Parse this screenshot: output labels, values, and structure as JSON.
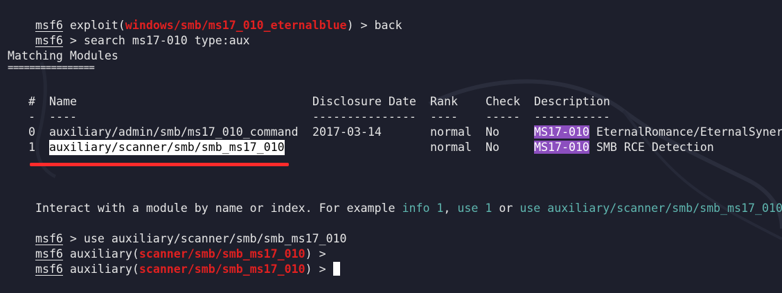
{
  "prompt": {
    "name": "msf6"
  },
  "lines": {
    "l1": {
      "pre": " exploit(",
      "module": "windows/smb/ms17_010_eternalblue",
      "post": ") > back"
    },
    "l2": {
      "text": " > search ms17-010 type:aux"
    },
    "matching_title": "Matching Modules",
    "matching_underline": "================",
    "headers": {
      "num": "#",
      "name": "Name",
      "date": "Disclosure Date",
      "rank": "Rank",
      "check": "Check",
      "desc": "Description"
    },
    "header_rules": {
      "num": "-",
      "name": "----",
      "date": "---------------",
      "rank": "----",
      "check": "-----",
      "desc": "-----------"
    },
    "rows": [
      {
        "num": "0",
        "name": "auxiliary/admin/smb/ms17_010_command",
        "date": "2017-03-14",
        "rank": "normal",
        "check": "No",
        "desc_tag": "MS17-010",
        "desc_rest": " EternalRomance/EternalSyner"
      },
      {
        "num": "1",
        "name": "auxiliary/scanner/smb/smb_ms17_010",
        "date": "",
        "rank": "normal",
        "check": "No",
        "desc_tag": "MS17-010",
        "desc_rest": " SMB RCE Detection"
      }
    ],
    "interact": {
      "pre": "Interact with a module by name or index. For example ",
      "ex1": "info 1",
      "sep1": ", ",
      "ex2": "use 1",
      "sep2": " or ",
      "ex3": "use auxiliary/scanner/smb/smb_ms17_010"
    },
    "l_use": {
      "text": " > use auxiliary/scanner/smb/smb_ms17_010"
    },
    "l_aux1": {
      "pre": " auxiliary(",
      "module": "scanner/smb/smb_ms17_010",
      "post": ") >"
    },
    "l_aux2": {
      "pre": " auxiliary(",
      "module": "scanner/smb/smb_ms17_010",
      "post": ") > "
    }
  },
  "colors": {
    "background": "#1d1f2c",
    "foreground": "#e6e6e6",
    "module_red": "#e02020",
    "example_teal": "#5fb7b0",
    "highlight_purple": "#8c4fbf",
    "annotation_red": "#ff2b2b"
  }
}
